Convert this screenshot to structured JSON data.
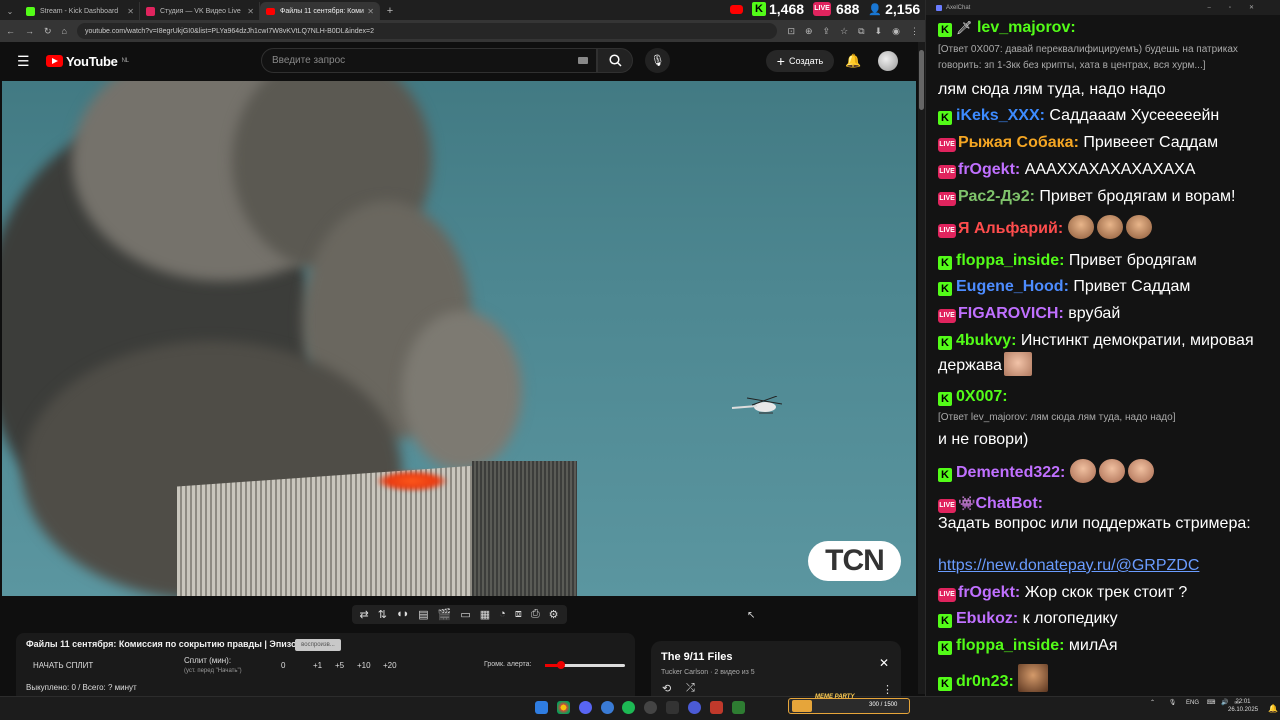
{
  "browser": {
    "tabs": [
      {
        "title": "Stream - Kick Dashboard",
        "icon": "kick-icon"
      },
      {
        "title": "Студия — VK Видео Live",
        "icon": "vk-live-icon"
      },
      {
        "title": "Файлы 11 сентября: Коми",
        "icon": "youtube-icon"
      }
    ],
    "new_tab": "+",
    "url": "youtube.com/watch?v=I8egrUkjGI0&list=PLYa964dzJh1cwI7W8vKVtLQ7NLH-B0DL&index=2"
  },
  "stream_stats": {
    "kick_viewers": "1,468",
    "vk_viewers": "688",
    "other_viewers": "2,156",
    "live_badge": "LIVE"
  },
  "youtube": {
    "logo_text": "YouTube",
    "region": "NL",
    "search_placeholder": "Введите запрос",
    "create_label": "Создать",
    "video_watermark": "TCN",
    "video_title": "Файлы 11 сентября: Комиссия по сокрытию правды | Эпизод 2",
    "title_badge": "воспроизв...",
    "split_button": "НАЧАТЬ СПЛИТ",
    "split_label": "Сплит (мин):",
    "split_hint": "(уст. перед \"Начать\")",
    "split_values": [
      "0",
      "+1",
      "+5",
      "+10",
      "+20"
    ],
    "alert_volume_label": "Громк. алерта:",
    "alert_volume_fraction": 0.2,
    "bought_text": "Выкуплено: 0 / Всего: ? минут",
    "playlist": {
      "title": "The 9/11 Files",
      "subtitle": "Tucker Carlson · 2 видео из 5",
      "close": "✕"
    }
  },
  "chat": {
    "window_title": "AxelChat",
    "messages": [
      {
        "platform": "kick",
        "badge": "🗡",
        "name": "lev_majorov:",
        "color": "#53fc18",
        "reply": "[Ответ 0X007: давай переквалифицируемъ) будешь на патриках говорить: зп 1-3кк без крипты, хата в центрах, вся хурм...]",
        "text": "лям сюда лям туда, надо надо"
      },
      {
        "platform": "kick",
        "name": "iKeks_XXX:",
        "color": "#3d8bff",
        "text": "Саддааам Хусееееейн"
      },
      {
        "platform": "vk",
        "name": "Рыжая Собака:",
        "color": "#f5a623",
        "text": "Привееет Саддам"
      },
      {
        "platform": "vk",
        "name": "frOgekt:",
        "color": "#c070ff",
        "text": "АААХХАХАХАХАХАХА"
      },
      {
        "platform": "vk",
        "name": "Рас2-Дэ2:",
        "color": "#7fc36b",
        "text": "Привет бродягам и ворам!"
      },
      {
        "platform": "vk",
        "name": "Я Альфарий:",
        "color": "#ff4d4d",
        "text": ""
      },
      {
        "platform": "kick",
        "name": "floppa_inside:",
        "color": "#53fc18",
        "text": "Привет бродягам"
      },
      {
        "platform": "kick",
        "name": "Eugene_Hood:",
        "color": "#4d8cff",
        "text": "Привет Саддам"
      },
      {
        "platform": "vk",
        "name": "FIGAROVICH:",
        "color": "#c070ff",
        "text": "врубай"
      },
      {
        "platform": "kick",
        "name": "4bukvy:",
        "color": "#53fc18",
        "text": "Инстинкт демократии, мировая держава"
      },
      {
        "platform": "kick",
        "name": "0X007:",
        "color": "#53fc18",
        "reply": "[Ответ lev_majorov: лям сюда лям туда, надо надо]",
        "text": "и не говори)"
      },
      {
        "platform": "kick",
        "name": "Demented322:",
        "color": "#c070ff",
        "text": ""
      },
      {
        "platform": "vk",
        "badge": "👾",
        "name": "ChatBot:",
        "color": "#c070ff",
        "text": "Задать вопрос или поддержать стримера:",
        "link": "https://new.donatepay.ru/@GRPZDC"
      },
      {
        "platform": "vk",
        "name": "frOgekt:",
        "color": "#c070ff",
        "text": "Жор скок трек стоит ?"
      },
      {
        "platform": "kick",
        "name": "Ebukoz:",
        "color": "#c070ff",
        "text": "к логопедику"
      },
      {
        "platform": "kick",
        "name": "floppa_inside:",
        "color": "#53fc18",
        "text": "милАя"
      },
      {
        "platform": "kick",
        "name": "dr0n23:",
        "color": "#53fc18",
        "text": ""
      }
    ]
  },
  "taskbar": {
    "meme_party": "MEME PARTY",
    "meme_progress": "300 / 1500",
    "lang": "ENG",
    "time": "22:01",
    "date": "26.10.2025"
  }
}
